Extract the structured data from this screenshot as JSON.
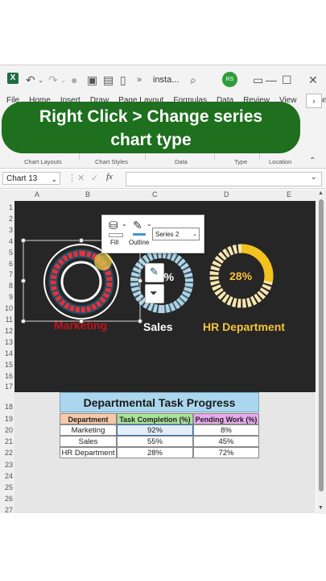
{
  "window": {
    "doc_name": "insta...",
    "avatar_initials": "RS"
  },
  "ribbon": {
    "tabs": [
      "File",
      "Home",
      "Insert",
      "Draw",
      "Page Layout",
      "Formulas",
      "Data",
      "Review",
      "View",
      "Automate"
    ],
    "groups": [
      "Chart Layouts",
      "Chart Styles",
      "Data",
      "Type",
      "Location"
    ]
  },
  "banner": {
    "line1": "Right Click > Change series",
    "line2": "chart type"
  },
  "formula_bar": {
    "name_box": "Chart 13",
    "fx_label": "fx",
    "value": ""
  },
  "columns": [
    "A",
    "B",
    "C",
    "D",
    "E"
  ],
  "rows": [
    "1",
    "2",
    "3",
    "4",
    "5",
    "6",
    "7",
    "8",
    "9",
    "10",
    "11",
    "12",
    "13",
    "14",
    "15",
    "16",
    "17",
    "18",
    "19",
    "20",
    "21",
    "22",
    "23",
    "24",
    "25",
    "26",
    "27"
  ],
  "charts": {
    "sales_label": "Sales",
    "sales_value": "55%",
    "marketing_label": "Marketing",
    "hr_label": "HR Department",
    "hr_value": "28%",
    "colors": {
      "marketing_label": "#c0141a",
      "sales_label": "#ffffff",
      "hr_label": "#f5c33b",
      "ring_dark": "#1d4f66",
      "ring_red": "#e2313a",
      "ring_gold": "#f2c21f",
      "ring_pale": "#f7e7b0"
    }
  },
  "mini_toolbar": {
    "fill_label": "Fill",
    "outline_label": "Outline",
    "series_selected": "Series 2"
  },
  "table": {
    "title": "Departmental Task Progress",
    "headers": [
      "Department",
      "Task Completion (%)",
      "Pending Work (%)"
    ],
    "rows": [
      [
        "Marketing",
        "92%",
        "8%"
      ],
      [
        "Sales",
        "55%",
        "45%"
      ],
      [
        "HR Department",
        "28%",
        "72%"
      ]
    ]
  }
}
